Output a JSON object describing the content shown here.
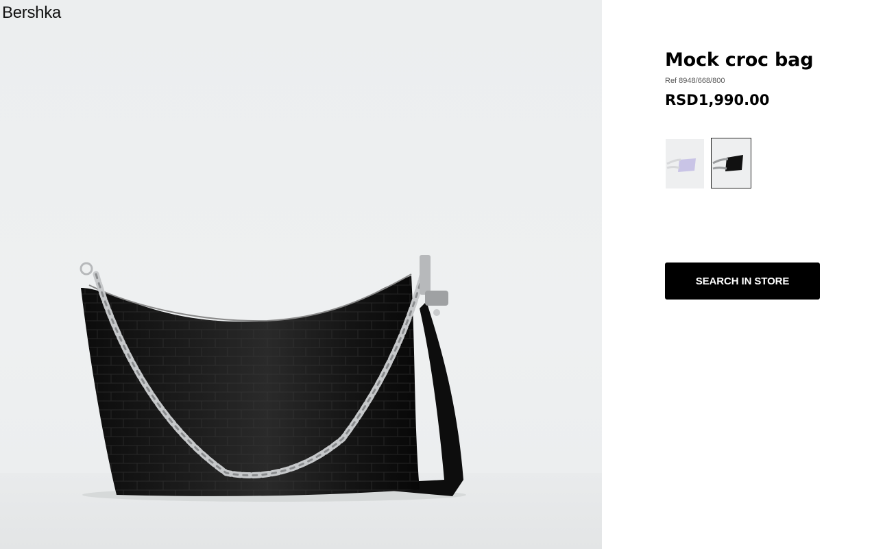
{
  "brand": {
    "logo_text": "Bershka"
  },
  "product": {
    "name": "Mock croc bag",
    "ref": "Ref 8948/668/800",
    "price": "RSD1,990.00",
    "image_alt": "Black mock croc shoulder bag with silver chain",
    "colors": [
      {
        "name": "lilac",
        "hex": "#c9c4e6"
      },
      {
        "name": "black",
        "hex": "#111111",
        "selected": true
      }
    ]
  },
  "actions": {
    "search_in_store_label": "SEARCH IN STORE"
  },
  "colors": {
    "button_bg": "#000000",
    "button_text": "#ffffff",
    "hero_bg": "#eef0f1"
  }
}
